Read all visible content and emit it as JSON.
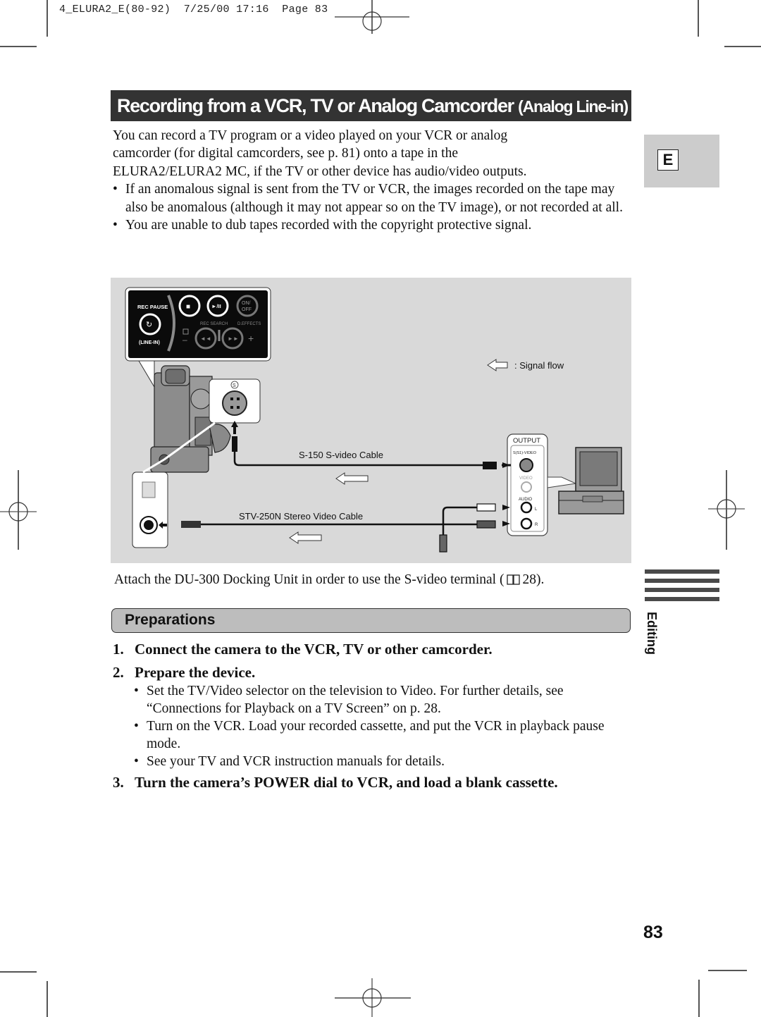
{
  "print_slug": {
    "file": "4_ELURA2_E(80-92)",
    "date": "7/25/00",
    "time": "17:16",
    "page_label": "Page 83"
  },
  "title": {
    "main": "Recording from a VCR, TV or Analog Camcorder",
    "suffix": "(Analog Line-in)"
  },
  "language_tab": "E",
  "intro": {
    "paragraph_lines": [
      "You can record a TV program or a video played on your VCR or analog",
      "camcorder (for digital camcorders, see p. 81) onto a tape in the",
      "ELURA2/ELURA2 MC, if the TV or other device has audio/video outputs."
    ],
    "bullets": [
      "If an anomalous signal is sent from the TV or VCR, the images recorded on the tape may also be anomalous (although it may not appear so on the TV image), or not recorded at all.",
      "You are unable to dub tapes recorded with the copyright protective signal."
    ],
    "bullet_char": "•"
  },
  "diagram": {
    "panel": {
      "rec_pause": "REC PAUSE",
      "line_in": "(LINE-IN)",
      "stop_glyph": "■",
      "play_pause_glyph": "►/II",
      "on_off": [
        "ON/",
        "OFF"
      ],
      "rec_search": "REC SEARCH",
      "d_effects": "D.EFFECTS",
      "minus": "–",
      "plus": "+",
      "rew_glyph": "◄◄",
      "ff_glyph": "►►"
    },
    "s_terminal_label": "S",
    "legend": ": Signal flow",
    "cable_svideo": "S-150 S-video Cable",
    "cable_stereo": "STV-250N Stereo Video Cable",
    "output_panel": {
      "title": "OUTPUT",
      "svideo": "S(S1)-VIDEO",
      "video": "VIDEO",
      "audio": "AUDIO",
      "left": "L",
      "right": "R"
    }
  },
  "caption": {
    "text": "Attach the DU-300 Docking Unit in order to use the S-video terminal (",
    "ref": "28).",
    "icon": "book-icon"
  },
  "section": {
    "heading": "Preparations"
  },
  "steps": [
    {
      "num": "1.",
      "text": "Connect the camera to the VCR, TV or other camcorder."
    },
    {
      "num": "2.",
      "text": "Prepare the device."
    },
    {
      "num": "3.",
      "text": "Turn the camera’s POWER dial to VCR, and load a blank cassette."
    }
  ],
  "step2_bullets": [
    "Set the TV/Video selector on the television to Video. For further details, see “Connections for Playback on a TV Screen” on p. 28.",
    "Turn on the VCR. Load your recorded cassette, and put the VCR in playback pause mode.",
    "See your TV and VCR instruction manuals for details."
  ],
  "side_section": "Editing",
  "page_number": "83"
}
